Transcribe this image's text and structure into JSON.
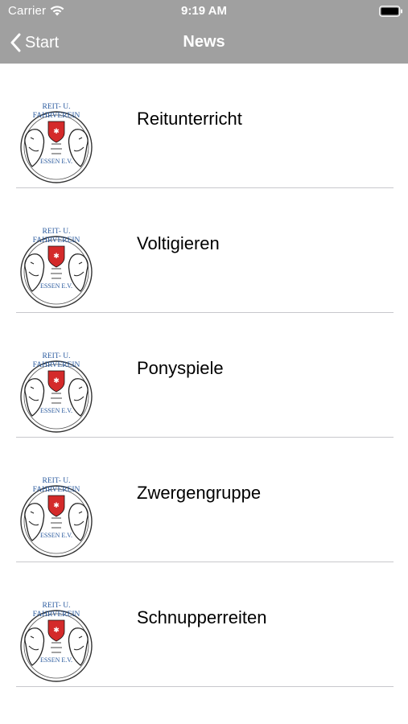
{
  "status_bar": {
    "carrier": "Carrier",
    "time": "9:19 AM",
    "wifi_icon": "wifi-icon",
    "battery_icon": "battery-icon"
  },
  "nav_bar": {
    "background_color": "#a0a0a0",
    "back_label": "Start",
    "back_icon": "chevron-left-icon",
    "title": "News"
  },
  "news_items": [
    {
      "title": "Reitunterricht",
      "logo": {
        "line1": "REIT- U.",
        "line2": "FAHRVEREIN",
        "line3": "ESSEN E.V."
      }
    },
    {
      "title": "Voltigieren",
      "logo": {
        "line1": "REIT- U.",
        "line2": "FAHRVEREIN",
        "line3": "ESSEN E.V."
      }
    },
    {
      "title": "Ponyspiele",
      "logo": {
        "line1": "REIT- U.",
        "line2": "FAHRVEREIN",
        "line3": "ESSEN E.V."
      }
    },
    {
      "title": "Zwergengruppe",
      "logo": {
        "line1": "REIT- U.",
        "line2": "FAHRVEREIN",
        "line3": "ESSEN E.V."
      }
    },
    {
      "title": "Schnupperreiten",
      "logo": {
        "line1": "REIT- U.",
        "line2": "FAHRVEREIN",
        "line3": "ESSEN E.V."
      }
    }
  ],
  "colors": {
    "logo_text": "#2a5a9e",
    "logo_shield": "#d42a2a",
    "separator": "#c8c8cc"
  }
}
